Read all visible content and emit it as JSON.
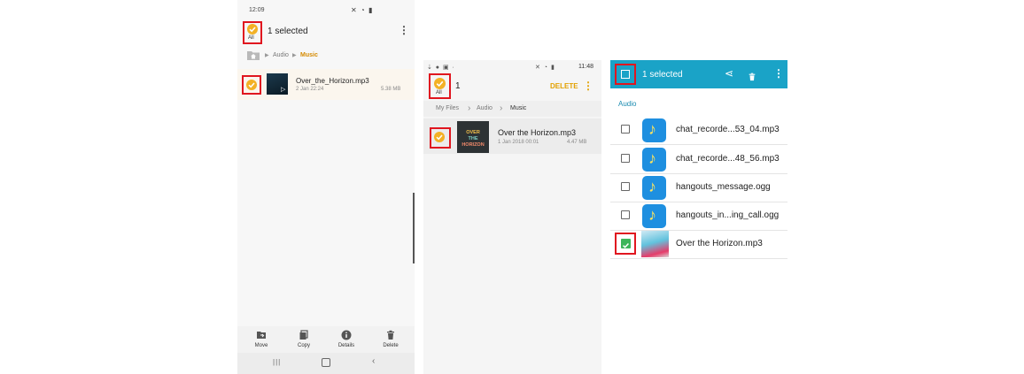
{
  "phone1": {
    "status_time": "12:09",
    "selected_text": "1 selected",
    "all_label": "All",
    "breadcrumb": [
      "Audio",
      "Music"
    ],
    "file": {
      "name": "Over_the_Horizon.mp3",
      "date": "2 Jan 22:24",
      "size": "5.38 MB"
    },
    "actions": [
      "Move",
      "Copy",
      "Details",
      "Delete"
    ]
  },
  "phone2": {
    "status_time": "11:48",
    "count": "1",
    "all_label": "All",
    "delete_label": "DELETE",
    "breadcrumb": [
      "My Files",
      "Audio",
      "Music"
    ],
    "file": {
      "name": "Over the Horizon.mp3",
      "date": "1 Jan 2018 00:01",
      "size": "4.47 MB"
    },
    "album_art_text": [
      "OVER",
      "THE",
      "HORIZON"
    ]
  },
  "phone3": {
    "selected_text": "1 selected",
    "section": "Audio",
    "files": [
      {
        "name": "chat_recorde...53_04.mp3",
        "checked": false
      },
      {
        "name": "chat_recorde...48_56.mp3",
        "checked": false
      },
      {
        "name": "hangouts_message.ogg",
        "checked": false
      },
      {
        "name": "hangouts_in...ing_call.ogg",
        "checked": false
      },
      {
        "name": "Over the Horizon.mp3",
        "checked": true
      }
    ]
  },
  "colors": {
    "accent_orange": "#f3b125",
    "highlight_red": "#e0161f",
    "toolbar_teal": "#1aa3c7",
    "check_green": "#3cb55a"
  }
}
